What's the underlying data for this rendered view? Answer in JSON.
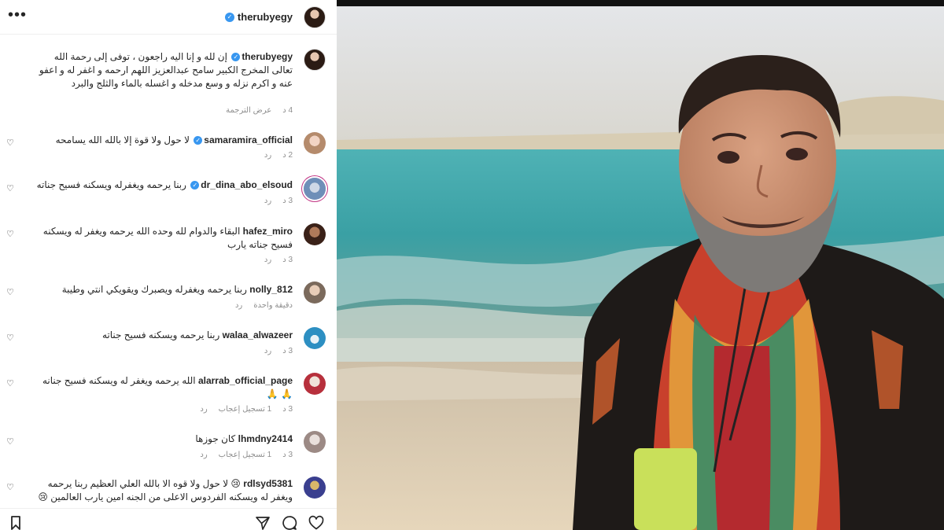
{
  "post": {
    "username": "therubyegy",
    "caption": "إن لله و إنا اليه راجعون ، توفى إلى رحمة الله تعالى المخرج الكبير سامح عبدالعزيز اللهم ارحمه و اغفر له و اعفو عنه و اكرم نزله و وسع مدخله و اغسله بالماء والثلج والبرد",
    "time": "4 د",
    "translate": "عرض الترجمة"
  },
  "comments": [
    {
      "username": "samaramira_official",
      "verified": true,
      "text": "لا حول ولا قوة إلا بالله الله يسامحه",
      "time": "2 د",
      "likes": "",
      "reply": "رد"
    },
    {
      "username": "dr_dina_abo_elsoud",
      "verified": true,
      "text": "ربنا يرحمه ويغفرله ويسكنه فسيح جناته",
      "time": "3 د",
      "likes": "",
      "reply": "رد"
    },
    {
      "username": "hafez_miro",
      "verified": false,
      "text": "البقاء والدوام لله وحده الله يرحمه ويغفر له ويسكنه فسيح جناته يارب",
      "time": "3 د",
      "likes": "",
      "reply": "رد"
    },
    {
      "username": "nolly_812",
      "verified": false,
      "text": "ربنا يرحمه ويغفرله ويصبرك ويقويكي انتي وطيبة",
      "time": "دقيقة واحدة",
      "likes": "",
      "reply": "رد"
    },
    {
      "username": "walaa_alwazeer",
      "verified": false,
      "text": "ربنا يرحمه ويسكنه فسيح جناته",
      "time": "3 د",
      "likes": "",
      "reply": "رد"
    },
    {
      "username": "alarrab_official_page",
      "verified": false,
      "text": "الله يرحمه ويغفر له ويسكنه فسيح جنانه 🙏 🙏",
      "time": "3 د",
      "likes": "1 تسجيل إعجاب",
      "reply": "رد"
    },
    {
      "username": "lhmdny2414",
      "verified": false,
      "text": "كان جوزها",
      "time": "3 د",
      "likes": "1 تسجيل إعجاب",
      "reply": "رد"
    },
    {
      "username": "rdlsyd5381",
      "verified": false,
      "text": "😢 لا حول ولا قوه الا بالله العلي العظيم ربنا يرحمه ويغفر له ويسكنه الفردوس الاعلى من الجنه امين يارب العالمين 😢",
      "time": "",
      "likes": "",
      "reply": ""
    }
  ],
  "icons": {
    "more": "more-options-icon",
    "verified": "verified-badge-icon",
    "like": "heart-icon",
    "save": "bookmark-icon",
    "share": "share-icon",
    "comment": "comment-icon"
  },
  "colors": {
    "verified": "#3897f0",
    "meta": "#8e8e8e",
    "text": "#262626"
  }
}
